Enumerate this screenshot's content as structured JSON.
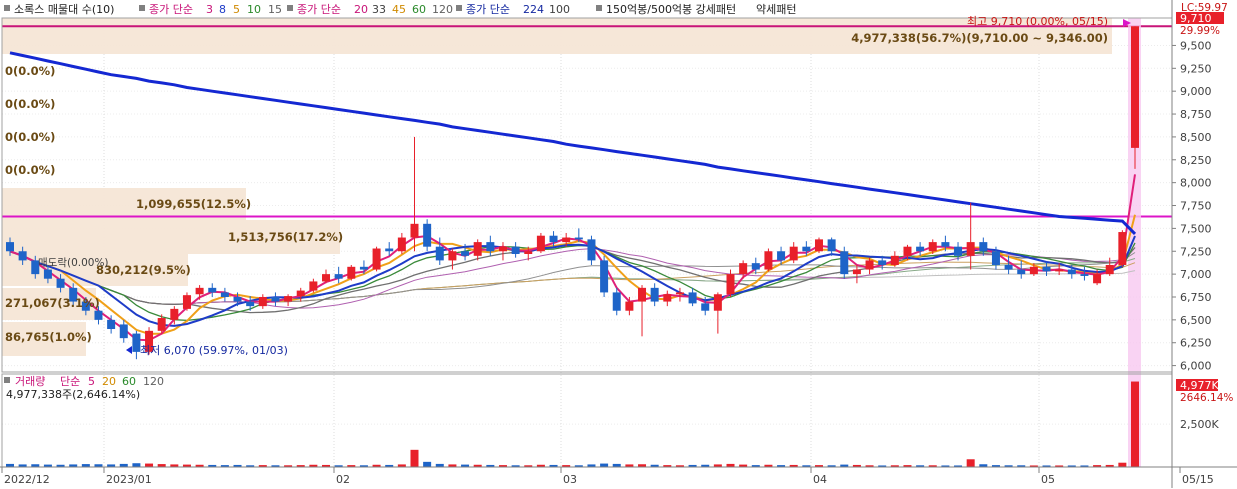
{
  "legend": {
    "title": "소록스 매물대 수(10)",
    "ma_price_label": "종가 단순",
    "ma_price_short": [
      "3",
      "8",
      "5",
      "10",
      "15"
    ],
    "ma_price_mid_label": "종가 단순",
    "ma_price_mid": [
      "20",
      "33",
      "45",
      "60",
      "120"
    ],
    "ma_price_long_label": "종가 단순",
    "ma_price_long": [
      "224",
      "100"
    ],
    "pattern": "150억봉/500억봉 강세패턴",
    "pattern2": "약세패턴"
  },
  "colors": {
    "ma3": "#e0207a",
    "ma8": "#1e3cc8",
    "ma5": "#f0a018",
    "ma10": "#3a8a3a",
    "ma15": "#707070",
    "ma224": "#1428d2",
    "up": "#e8202a",
    "down": "#1e64c8",
    "magenta": "#dc14c8",
    "volband": "#f5e6d6"
  },
  "price_axis": {
    "ticks": [
      "9,500",
      "9,250",
      "9,000",
      "8,750",
      "8,500",
      "8,250",
      "8,000",
      "7,750",
      "7,500",
      "7,250",
      "7,000",
      "6,750",
      "6,500",
      "6,250",
      "6,000"
    ],
    "current_price": "9,710",
    "current_pct": "29.99%",
    "limit_label": "LC:59.97"
  },
  "volume_axis": {
    "ticks": [
      "2,500K"
    ],
    "current_volume": "4,977K",
    "current_pct": "2646.14%"
  },
  "annotations": {
    "high": "최고 9,710 (0.00%, 05/15)",
    "high_band": "4,977,338(56.7%)(9,710.00 ~ 9,346.00)",
    "low": "최저 6,070 (59.97%, 01/03)",
    "vp_1": "1,099,655(12.5%)",
    "vp_2": "1,513,756(17.2%)",
    "vp_3": "830,212(9.5%)",
    "vp_4": "271,067(3.1%)",
    "vp_5": "86,765(1.0%)",
    "zero_labels": [
      "0(0.0%)",
      "0(0.0%)",
      "0(0.0%)",
      "0(0.0%)"
    ],
    "sell_label": "매도락(0.00%)"
  },
  "volume_legend": {
    "label": "거래량",
    "ma_label": "단순",
    "periods": [
      "5",
      "20",
      "60",
      "120"
    ],
    "today": "4,977,338주(2,646.14%)"
  },
  "x_axis": {
    "labels": [
      "2022/12",
      "2023/01",
      "02",
      "03",
      "04",
      "05",
      "05/15"
    ]
  },
  "chart_data": {
    "type": "candlestick",
    "title": "소록스 매물대 수(10)",
    "x_start": "2022/12",
    "x_end": "05/15",
    "ylim": [
      5930,
      9800
    ],
    "volume_ylim": [
      0,
      5300000
    ],
    "candles": [
      {
        "o": 7350,
        "h": 7400,
        "l": 7200,
        "c": 7250
      },
      {
        "o": 7250,
        "h": 7300,
        "l": 7100,
        "c": 7150
      },
      {
        "o": 7150,
        "h": 7200,
        "l": 6950,
        "c": 7000
      },
      {
        "o": 7050,
        "h": 7100,
        "l": 6900,
        "c": 6950
      },
      {
        "o": 6950,
        "h": 7000,
        "l": 6800,
        "c": 6850
      },
      {
        "o": 6850,
        "h": 6900,
        "l": 6650,
        "c": 6700
      },
      {
        "o": 6700,
        "h": 6750,
        "l": 6550,
        "c": 6600
      },
      {
        "o": 6600,
        "h": 6650,
        "l": 6450,
        "c": 6500
      },
      {
        "o": 6500,
        "h": 6550,
        "l": 6350,
        "c": 6400
      },
      {
        "o": 6450,
        "h": 6500,
        "l": 6250,
        "c": 6300
      },
      {
        "o": 6350,
        "h": 6380,
        "l": 6070,
        "c": 6150
      },
      {
        "o": 6150,
        "h": 6420,
        "l": 6120,
        "c": 6380
      },
      {
        "o": 6380,
        "h": 6560,
        "l": 6350,
        "c": 6520
      },
      {
        "o": 6500,
        "h": 6650,
        "l": 6450,
        "c": 6620
      },
      {
        "o": 6620,
        "h": 6800,
        "l": 6600,
        "c": 6770
      },
      {
        "o": 6780,
        "h": 6880,
        "l": 6720,
        "c": 6850
      },
      {
        "o": 6850,
        "h": 6900,
        "l": 6750,
        "c": 6800
      },
      {
        "o": 6800,
        "h": 6850,
        "l": 6700,
        "c": 6750
      },
      {
        "o": 6750,
        "h": 6800,
        "l": 6650,
        "c": 6700
      },
      {
        "o": 6700,
        "h": 6760,
        "l": 6600,
        "c": 6650
      },
      {
        "o": 6650,
        "h": 6780,
        "l": 6620,
        "c": 6750
      },
      {
        "o": 6750,
        "h": 6800,
        "l": 6650,
        "c": 6700
      },
      {
        "o": 6700,
        "h": 6780,
        "l": 6650,
        "c": 6760
      },
      {
        "o": 6760,
        "h": 6850,
        "l": 6700,
        "c": 6820
      },
      {
        "o": 6820,
        "h": 6950,
        "l": 6800,
        "c": 6920
      },
      {
        "o": 6920,
        "h": 7050,
        "l": 6900,
        "c": 7000
      },
      {
        "o": 7000,
        "h": 7080,
        "l": 6900,
        "c": 6950
      },
      {
        "o": 6950,
        "h": 7100,
        "l": 6930,
        "c": 7080
      },
      {
        "o": 7080,
        "h": 7150,
        "l": 7000,
        "c": 7050
      },
      {
        "o": 7050,
        "h": 7300,
        "l": 7030,
        "c": 7280
      },
      {
        "o": 7280,
        "h": 7350,
        "l": 7200,
        "c": 7250
      },
      {
        "o": 7250,
        "h": 7450,
        "l": 7220,
        "c": 7400
      },
      {
        "o": 7400,
        "h": 8500,
        "l": 7250,
        "c": 7550
      },
      {
        "o": 7550,
        "h": 7600,
        "l": 7250,
        "c": 7300
      },
      {
        "o": 7300,
        "h": 7400,
        "l": 7100,
        "c": 7150
      },
      {
        "o": 7150,
        "h": 7280,
        "l": 7050,
        "c": 7250
      },
      {
        "o": 7250,
        "h": 7330,
        "l": 7150,
        "c": 7200
      },
      {
        "o": 7200,
        "h": 7380,
        "l": 7150,
        "c": 7350
      },
      {
        "o": 7350,
        "h": 7420,
        "l": 7200,
        "c": 7250
      },
      {
        "o": 7250,
        "h": 7350,
        "l": 7150,
        "c": 7300
      },
      {
        "o": 7300,
        "h": 7350,
        "l": 7180,
        "c": 7220
      },
      {
        "o": 7220,
        "h": 7300,
        "l": 7150,
        "c": 7250
      },
      {
        "o": 7250,
        "h": 7450,
        "l": 7230,
        "c": 7420
      },
      {
        "o": 7420,
        "h": 7470,
        "l": 7300,
        "c": 7350
      },
      {
        "o": 7350,
        "h": 7450,
        "l": 7300,
        "c": 7400
      },
      {
        "o": 7400,
        "h": 7500,
        "l": 7350,
        "c": 7380
      },
      {
        "o": 7380,
        "h": 7420,
        "l": 7100,
        "c": 7150
      },
      {
        "o": 7150,
        "h": 7200,
        "l": 6750,
        "c": 6800
      },
      {
        "o": 6800,
        "h": 6850,
        "l": 6550,
        "c": 6600
      },
      {
        "o": 6600,
        "h": 6750,
        "l": 6550,
        "c": 6700
      },
      {
        "o": 6700,
        "h": 6880,
        "l": 6320,
        "c": 6850
      },
      {
        "o": 6850,
        "h": 6900,
        "l": 6650,
        "c": 6700
      },
      {
        "o": 6700,
        "h": 6820,
        "l": 6650,
        "c": 6780
      },
      {
        "o": 6780,
        "h": 6850,
        "l": 6700,
        "c": 6800
      },
      {
        "o": 6800,
        "h": 6850,
        "l": 6650,
        "c": 6680
      },
      {
        "o": 6680,
        "h": 6750,
        "l": 6550,
        "c": 6600
      },
      {
        "o": 6600,
        "h": 6800,
        "l": 6350,
        "c": 6780
      },
      {
        "o": 6780,
        "h": 7050,
        "l": 6750,
        "c": 7000
      },
      {
        "o": 7000,
        "h": 7150,
        "l": 6950,
        "c": 7120
      },
      {
        "o": 7120,
        "h": 7180,
        "l": 7000,
        "c": 7050
      },
      {
        "o": 7050,
        "h": 7280,
        "l": 7030,
        "c": 7250
      },
      {
        "o": 7250,
        "h": 7300,
        "l": 7100,
        "c": 7150
      },
      {
        "o": 7150,
        "h": 7350,
        "l": 7120,
        "c": 7300
      },
      {
        "o": 7300,
        "h": 7360,
        "l": 7200,
        "c": 7250
      },
      {
        "o": 7250,
        "h": 7400,
        "l": 7230,
        "c": 7380
      },
      {
        "o": 7380,
        "h": 7400,
        "l": 7200,
        "c": 7250
      },
      {
        "o": 7250,
        "h": 7300,
        "l": 6950,
        "c": 7000
      },
      {
        "o": 7000,
        "h": 7100,
        "l": 6900,
        "c": 7050
      },
      {
        "o": 7050,
        "h": 7180,
        "l": 7000,
        "c": 7150
      },
      {
        "o": 7150,
        "h": 7200,
        "l": 7050,
        "c": 7100
      },
      {
        "o": 7100,
        "h": 7250,
        "l": 7080,
        "c": 7200
      },
      {
        "o": 7200,
        "h": 7320,
        "l": 7150,
        "c": 7300
      },
      {
        "o": 7300,
        "h": 7350,
        "l": 7200,
        "c": 7250
      },
      {
        "o": 7250,
        "h": 7380,
        "l": 7220,
        "c": 7350
      },
      {
        "o": 7350,
        "h": 7420,
        "l": 7250,
        "c": 7300
      },
      {
        "o": 7300,
        "h": 7350,
        "l": 7150,
        "c": 7200
      },
      {
        "o": 7200,
        "h": 7780,
        "l": 7050,
        "c": 7350
      },
      {
        "o": 7350,
        "h": 7400,
        "l": 7200,
        "c": 7250
      },
      {
        "o": 7250,
        "h": 7300,
        "l": 7050,
        "c": 7100
      },
      {
        "o": 7100,
        "h": 7200,
        "l": 7000,
        "c": 7050
      },
      {
        "o": 7050,
        "h": 7150,
        "l": 6950,
        "c": 7000
      },
      {
        "o": 7000,
        "h": 7120,
        "l": 6980,
        "c": 7080
      },
      {
        "o": 7080,
        "h": 7130,
        "l": 6980,
        "c": 7030
      },
      {
        "o": 7030,
        "h": 7120,
        "l": 6990,
        "c": 7050
      },
      {
        "o": 7050,
        "h": 7100,
        "l": 6950,
        "c": 7000
      },
      {
        "o": 7000,
        "h": 7080,
        "l": 6930,
        "c": 6980
      },
      {
        "o": 6900,
        "h": 7050,
        "l": 6880,
        "c": 7000
      },
      {
        "o": 7000,
        "h": 7180,
        "l": 6980,
        "c": 7100
      },
      {
        "o": 7100,
        "h": 7480,
        "l": 7080,
        "c": 7460
      },
      {
        "o": 8380,
        "h": 9710,
        "l": 8150,
        "c": 9710
      }
    ],
    "volume": [
      180000,
      150000,
      160000,
      140000,
      130000,
      150000,
      170000,
      160000,
      150000,
      180000,
      220000,
      200000,
      170000,
      150000,
      140000,
      130000,
      120000,
      110000,
      120000,
      100000,
      110000,
      100000,
      100000,
      110000,
      130000,
      120000,
      100000,
      110000,
      100000,
      130000,
      120000,
      150000,
      1000000,
      300000,
      180000,
      150000,
      140000,
      130000,
      120000,
      110000,
      100000,
      100000,
      130000,
      120000,
      110000,
      100000,
      150000,
      200000,
      180000,
      150000,
      160000,
      130000,
      110000,
      100000,
      120000,
      130000,
      150000,
      180000,
      140000,
      110000,
      130000,
      110000,
      120000,
      100000,
      110000,
      100000,
      140000,
      120000,
      100000,
      90000,
      100000,
      110000,
      100000,
      100000,
      90000,
      90000,
      450000,
      160000,
      110000,
      100000,
      100000,
      90000,
      90000,
      90000,
      90000,
      90000,
      110000,
      120000,
      250000,
      4977338
    ],
    "ma224": [
      9420,
      9390,
      9360,
      9330,
      9300,
      9270,
      9240,
      9210,
      9180,
      9160,
      9140,
      9110,
      9090,
      9070,
      9040,
      9020,
      9000,
      8980,
      8960,
      8940,
      8920,
      8900,
      8880,
      8860,
      8840,
      8820,
      8800,
      8780,
      8760,
      8740,
      8720,
      8700,
      8680,
      8660,
      8640,
      8610,
      8590,
      8570,
      8550,
      8530,
      8510,
      8490,
      8470,
      8450,
      8420,
      8400,
      8380,
      8360,
      8340,
      8320,
      8300,
      8280,
      8260,
      8240,
      8220,
      8200,
      8170,
      8150,
      8130,
      8110,
      8090,
      8070,
      8050,
      8030,
      8010,
      7990,
      7970,
      7950,
      7930,
      7910,
      7890,
      7870,
      7850,
      7830,
      7810,
      7790,
      7770,
      7750,
      7730,
      7710,
      7690,
      7670,
      7650,
      7630,
      7620,
      7610,
      7600,
      7590,
      7580,
      7440
    ],
    "volume_profile": [
      {
        "label": "1,099,655(12.5%)"
      },
      {
        "label": "1,513,756(17.2%)"
      },
      {
        "label": "830,212(9.5%)"
      },
      {
        "label": "271,067(3.1%)"
      },
      {
        "label": "86,765(1.0%)"
      }
    ],
    "reference_line": 7630,
    "high": 9710,
    "low": 6070
  }
}
